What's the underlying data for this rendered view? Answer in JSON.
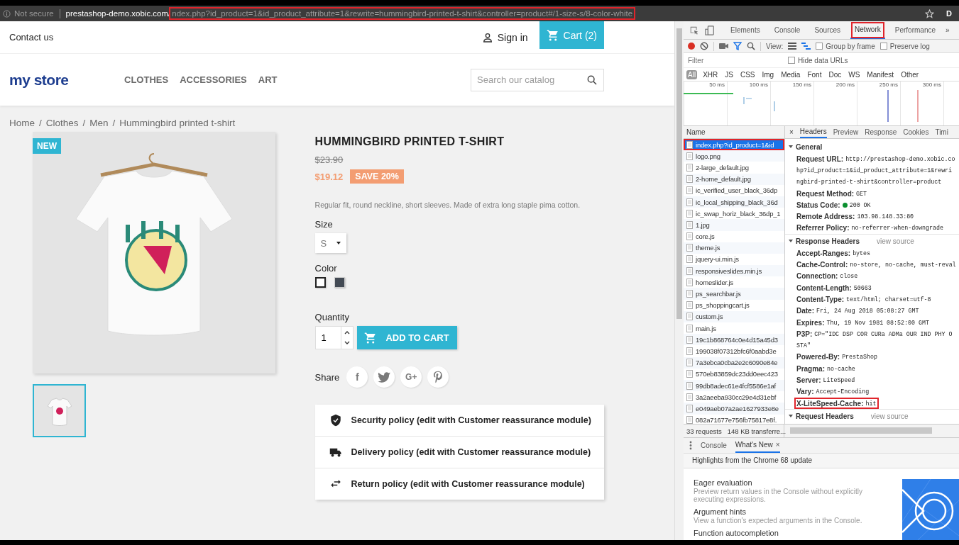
{
  "address_bar": {
    "security": "Not secure",
    "host": "prestashop-demo.xobic.com/",
    "path": "ndex.php?id_product=1&id_product_attribute=1&rewrite=hummingbird-printed-t-shirt&controller=product#/1-size-s/8-color-white",
    "path_highlighted": true,
    "profile": "D"
  },
  "store": {
    "contact": "Contact us",
    "sign_in": "Sign in",
    "cart": "Cart (2)",
    "logo": "my store",
    "nav": [
      "CLOTHES",
      "ACCESSORIES",
      "ART"
    ],
    "search": {
      "placeholder": "Search our catalog"
    },
    "breadcrumb": [
      "Home",
      "Clothes",
      "Men",
      "Hummingbird printed t-shirt"
    ],
    "breadcrumb_separator": "/",
    "product": {
      "badge": "NEW",
      "title": "HUMMINGBIRD PRINTED T-SHIRT",
      "old_price": "$23.90",
      "price": "$19.12",
      "discount": "SAVE 20%",
      "description": "Regular fit, round neckline, short sleeves. Made of extra long staple pima cotton.",
      "size_label": "Size",
      "size": "S",
      "color_label": "Color",
      "colors": [
        {
          "color": "#ffffff",
          "selected": true
        },
        {
          "color": "#434a54",
          "selected": false
        }
      ],
      "quantity_label": "Quantity",
      "quantity": "1",
      "add_to_cart": "ADD TO CART",
      "share_label": "Share",
      "share": [
        {
          "kind": "facebook",
          "label": "f"
        },
        {
          "kind": "twitter"
        },
        {
          "kind": "googleplus",
          "label": "G+"
        },
        {
          "kind": "pinterest"
        }
      ],
      "thumbnails": [
        {
          "selected": true
        }
      ],
      "reassurance": [
        {
          "kind": "shield",
          "text": "Security policy (edit with Customer reassurance module)"
        },
        {
          "kind": "truck",
          "text": "Delivery policy (edit with Customer reassurance module)"
        },
        {
          "kind": "swap",
          "text": "Return policy (edit with Customer reassurance module)"
        }
      ]
    }
  },
  "devtools": {
    "tabs": [
      {
        "label": "Elements",
        "selected": false
      },
      {
        "label": "Console",
        "selected": false
      },
      {
        "label": "Sources",
        "selected": false
      },
      {
        "label": "Network",
        "selected": true,
        "highlighted": true
      },
      {
        "label": "Performance",
        "selected": false
      }
    ],
    "more": "»",
    "toolbar": {
      "recording": true,
      "view_label": "View:",
      "options": [
        {
          "label": "Group by frame",
          "checked": false
        },
        {
          "label": "Preserve log",
          "checked": false
        }
      ]
    },
    "filter": {
      "placeholder": "Filter"
    },
    "hide_data_urls": {
      "label": "Hide data URLs",
      "checked": false
    },
    "types": [
      {
        "label": "All",
        "selected": true
      },
      {
        "label": "XHR",
        "selected": false
      },
      {
        "label": "JS",
        "selected": false
      },
      {
        "label": "CSS",
        "selected": false
      },
      {
        "label": "Img",
        "selected": false
      },
      {
        "label": "Media",
        "selected": false
      },
      {
        "label": "Font",
        "selected": false
      },
      {
        "label": "Doc",
        "selected": false
      },
      {
        "label": "WS",
        "selected": false
      },
      {
        "label": "Manifest",
        "selected": false
      },
      {
        "label": "Other",
        "selected": false
      }
    ],
    "overview_ticks": [
      "50 ms",
      "100 ms",
      "150 ms",
      "200 ms",
      "250 ms",
      "300 ms"
    ],
    "requests": {
      "header": "Name",
      "items": [
        {
          "name": "index.php?id_product=1&id",
          "selected": true,
          "highlighted": true
        },
        {
          "name": "logo.png",
          "selected": false
        },
        {
          "name": "2-large_default.jpg",
          "selected": false
        },
        {
          "name": "2-home_default.jpg",
          "selected": false
        },
        {
          "name": "ic_verified_user_black_36dp",
          "selected": false
        },
        {
          "name": "ic_local_shipping_black_36d",
          "selected": false
        },
        {
          "name": "ic_swap_horiz_black_36dp_1",
          "selected": false
        },
        {
          "name": "1.jpg",
          "selected": false
        },
        {
          "name": "core.js",
          "selected": false
        },
        {
          "name": "theme.js",
          "selected": false
        },
        {
          "name": "jquery-ui.min.js",
          "selected": false
        },
        {
          "name": "responsiveslides.min.js",
          "selected": false
        },
        {
          "name": "homeslider.js",
          "selected": false
        },
        {
          "name": "ps_searchbar.js",
          "selected": false
        },
        {
          "name": "ps_shoppingcart.js",
          "selected": false
        },
        {
          "name": "custom.js",
          "selected": false
        },
        {
          "name": "main.js",
          "selected": false
        },
        {
          "name": "19c1b868764c0e4d15a45d3",
          "selected": false
        },
        {
          "name": "199038f07312bfc6f0aabd3e",
          "selected": false
        },
        {
          "name": "7a3ebca0cba2e2c6090e84e",
          "selected": false
        },
        {
          "name": "570eb83859dc23dd0eec423",
          "selected": false
        },
        {
          "name": "99db8adec61e4fcf5586e1af",
          "selected": false
        },
        {
          "name": "3a2aeeba930cc29e4d31ebf",
          "selected": false
        },
        {
          "name": "e049aeb07a2ae1627933e8e",
          "selected": false
        },
        {
          "name": "082a71677e756fb75817e8f.",
          "selected": false
        }
      ],
      "summary": [
        "33 requests",
        "148 KB transferre..."
      ]
    },
    "detail": {
      "close": "×",
      "tabs": [
        {
          "label": "Headers",
          "selected": true
        },
        {
          "label": "Preview",
          "selected": false
        },
        {
          "label": "Response",
          "selected": false
        },
        {
          "label": "Cookies",
          "selected": false
        },
        {
          "label": "Timi",
          "selected": false
        }
      ],
      "sections": [
        {
          "title": "General",
          "expanded": true,
          "rows": [
            {
              "key": "Request URL:",
              "value": "http://prestashop-demo.xobic.co"
            },
            {
              "value": "hp?id_product=1&id_product_attribute=1&rewri"
            },
            {
              "value": "ngbird-printed-t-shirt&controller=product"
            },
            {
              "key": "Request Method:",
              "value": "GET"
            },
            {
              "key": "Status Code:",
              "value": "200 OK",
              "status_ok": true
            },
            {
              "key": "Remote Address:",
              "value": "103.98.148.33:80"
            },
            {
              "key": "Referrer Policy:",
              "value": "no-referrer-when-downgrade"
            }
          ]
        },
        {
          "title": "Response Headers",
          "link": "view source",
          "expanded": true,
          "rows": [
            {
              "key": "Accept-Ranges:",
              "value": "bytes"
            },
            {
              "key": "Cache-Control:",
              "value": "no-store, no-cache, must-reval"
            },
            {
              "key": "Connection:",
              "value": "close"
            },
            {
              "key": "Content-Length:",
              "value": "50663"
            },
            {
              "key": "Content-Type:",
              "value": "text/html; charset=utf-8"
            },
            {
              "key": "Date:",
              "value": "Fri, 24 Aug 2018 05:08:27 GMT"
            },
            {
              "key": "Expires:",
              "value": "Thu, 19 Nov 1981 08:52:00 GMT"
            },
            {
              "key": "P3P:",
              "value": "CP=\"IDC DSP COR CURa ADMa OUR IND PHY O"
            },
            {
              "value": "STA\""
            },
            {
              "key": "Powered-By:",
              "value": "PrestaShop"
            },
            {
              "key": "Pragma:",
              "value": "no-cache"
            },
            {
              "key": "Server:",
              "value": "LiteSpeed"
            },
            {
              "key": "Vary:",
              "value": "Accept-Encoding"
            },
            {
              "key": "X-LiteSpeed-Cache:",
              "value": "hit",
              "highlighted": true
            }
          ]
        },
        {
          "title": "Request Headers",
          "link": "view source",
          "expanded": true
        }
      ]
    },
    "drawer": {
      "tabs": [
        {
          "label": "Console",
          "selected": false
        },
        {
          "label": "What's New",
          "selected": true,
          "close": "×"
        }
      ],
      "heading": "Highlights from the Chrome 68 update",
      "items": [
        {
          "title": "Eager evaluation",
          "text": "Preview return values in the Console without explicitly executing expressions."
        },
        {
          "title": "Argument hints",
          "text": "View a function's expected arguments in the Console."
        },
        {
          "title": "Function autocompletion"
        }
      ]
    }
  }
}
